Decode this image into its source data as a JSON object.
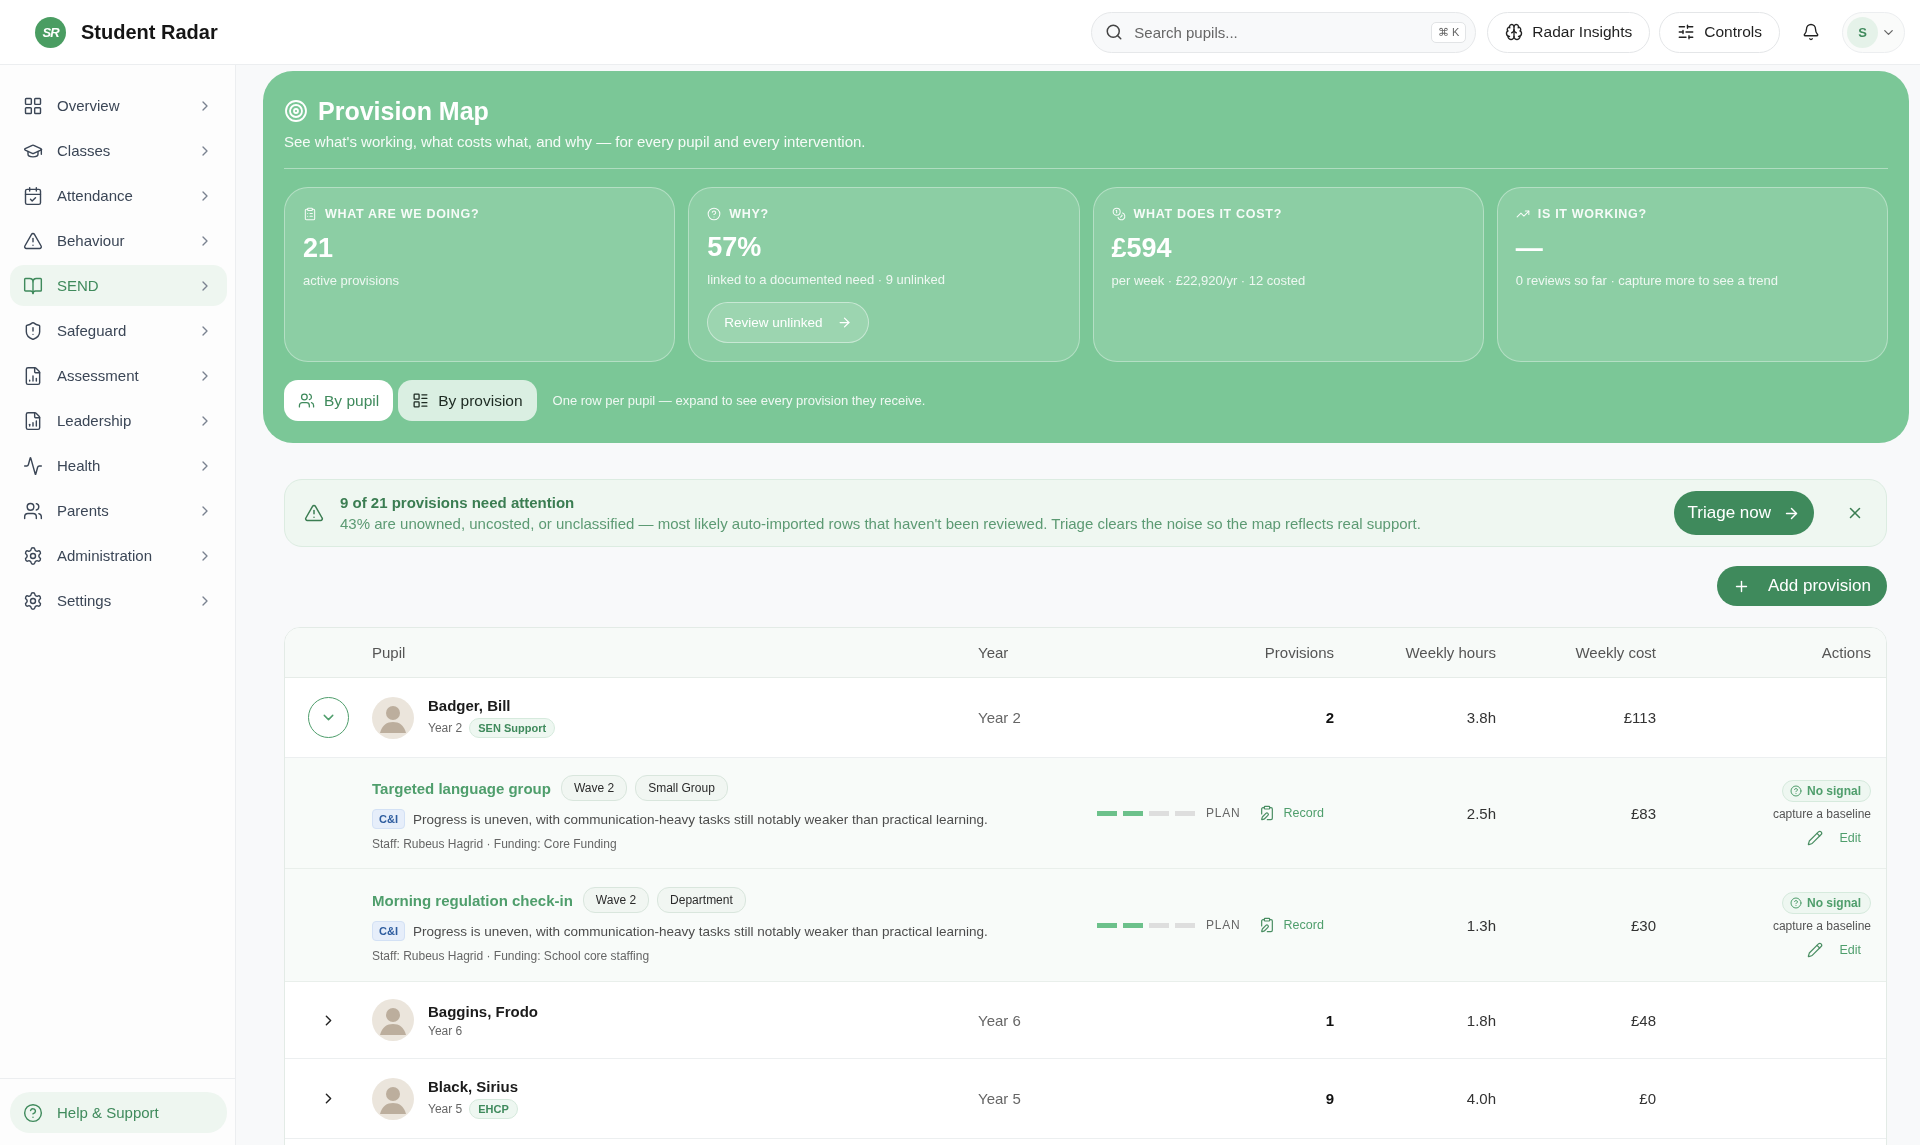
{
  "app": {
    "logo": "SR",
    "name": "Student Radar"
  },
  "header": {
    "search": {
      "placeholder": "Search pupils...",
      "shortcut": "⌘ K"
    },
    "buttons": [
      {
        "label": "Radar Insights"
      },
      {
        "label": "Controls"
      }
    ],
    "account": {
      "initial": "S"
    }
  },
  "sidebar": {
    "items": [
      {
        "label": "Overview",
        "selected": false
      },
      {
        "label": "Classes",
        "selected": false
      },
      {
        "label": "Attendance",
        "selected": false
      },
      {
        "label": "Behaviour",
        "selected": false
      },
      {
        "label": "SEND",
        "selected": true
      },
      {
        "label": "Safeguard",
        "selected": false
      },
      {
        "label": "Assessment",
        "selected": false
      },
      {
        "label": "Leadership",
        "selected": false
      },
      {
        "label": "Health",
        "selected": false
      },
      {
        "label": "Parents",
        "selected": false
      },
      {
        "label": "Administration",
        "selected": false
      },
      {
        "label": "Settings",
        "selected": false
      }
    ],
    "help": {
      "label": "Help & Support"
    }
  },
  "hero": {
    "title": "Provision Map",
    "subtitle": "See what's working, what costs what, and why — for every pupil and every intervention.",
    "stats": [
      {
        "label": "WHAT ARE WE DOING?",
        "value": "21",
        "caption": "active provisions"
      },
      {
        "label": "WHY?",
        "value": "57%",
        "caption": "linked to a documented need · 9 unlinked",
        "action": "Review unlinked"
      },
      {
        "label": "WHAT DOES IT COST?",
        "value": "£594",
        "caption": "per week · £22,920/yr · 12 costed"
      },
      {
        "label": "IS IT WORKING?",
        "value": "—",
        "caption": "0 reviews so far · capture more to see a trend"
      }
    ],
    "view_toggle": [
      {
        "label": "By pupil",
        "selected": true
      },
      {
        "label": "By provision",
        "selected": false
      }
    ],
    "view_hint": "One row per pupil — expand to see every provision they receive."
  },
  "alert": {
    "title": "9 of 21 provisions need attention",
    "message": "43% are unowned, uncosted, or unclassified — most likely auto-imported rows that haven't been reviewed. Triage clears the noise so the map reflects real support.",
    "action": "Triage now"
  },
  "add_button": {
    "label": "Add provision"
  },
  "table": {
    "columns": [
      "Pupil",
      "Year",
      "Provisions",
      "Weekly hours",
      "Weekly cost",
      "Actions"
    ],
    "rows": [
      {
        "name": "Badger, Bill",
        "year_line": "Year 2",
        "tag": "SEN Support",
        "year": "Year 2",
        "provisions_count": "2",
        "hours": "3.8h",
        "cost": "£113",
        "expanded": true,
        "provisions": [
          {
            "name": "Targeted language group",
            "tags": [
              "Wave 2",
              "Small Group"
            ],
            "need": "C&I",
            "note": "Progress is uneven, with communication-heavy tasks still notably weaker than practical learning.",
            "meta": "Staff: Rubeus Hagrid · Funding: Core Funding",
            "level": 0.5,
            "stage": "PLAN",
            "record": "Record",
            "hours": "2.5h",
            "cost": "£83",
            "signal": "No signal",
            "signal_hint": "capture a baseline",
            "edit": "Edit"
          },
          {
            "name": "Morning regulation check-in",
            "tags": [
              "Wave 2",
              "Department"
            ],
            "need": "C&I",
            "note": "Progress is uneven, with communication-heavy tasks still notably weaker than practical learning.",
            "meta": "Staff: Rubeus Hagrid · Funding: School core staffing",
            "level": 0.5,
            "stage": "PLAN",
            "record": "Record",
            "hours": "1.3h",
            "cost": "£30",
            "signal": "No signal",
            "signal_hint": "capture a baseline",
            "edit": "Edit"
          }
        ]
      },
      {
        "name": "Baggins, Frodo",
        "year_line": "Year 6",
        "year": "Year 6",
        "provisions_count": "1",
        "hours": "1.8h",
        "cost": "£48",
        "expanded": false
      },
      {
        "name": "Black, Sirius",
        "year_line": "Year 5",
        "tag": "EHCP",
        "year": "Year 5",
        "provisions_count": "9",
        "hours": "4.0h",
        "cost": "£0",
        "expanded": false
      }
    ]
  }
}
